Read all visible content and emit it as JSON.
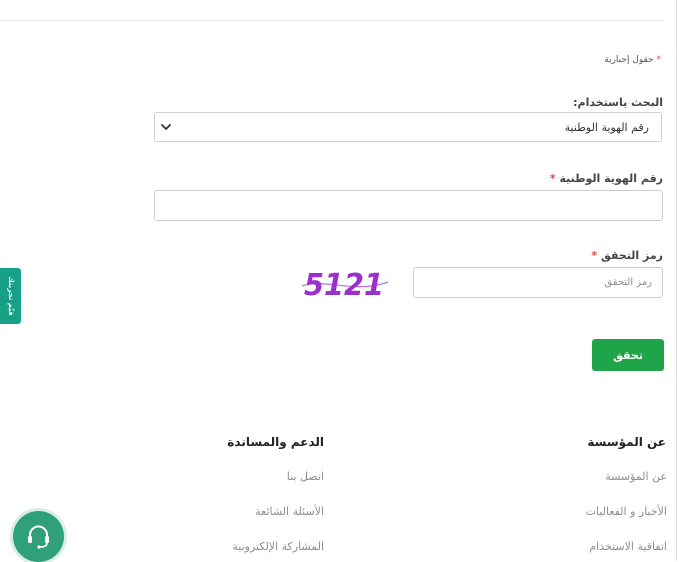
{
  "form": {
    "required_note": "حقول إجبارية",
    "search_by_label": "البحث باستخدام:",
    "search_by_value": "رقم الهوية الوطنية",
    "id_label": "رقم الهوية الوطنية",
    "captcha_label": "رمز التحقق",
    "captcha_placeholder": "رمز التحقق",
    "captcha_text": "5121",
    "submit_label": "تحقق"
  },
  "side_tab": {
    "label": "قيّم تجربتك"
  },
  "footer": {
    "about": {
      "title": "عن المؤسسة",
      "links": [
        "عن المؤسسة",
        "الأخبار و الفعاليات",
        "اتفاقية الاستخدام"
      ]
    },
    "support": {
      "title": "الدعم والمساندة",
      "links": [
        "اتصل بنا",
        "الأسئلة الشائعة",
        "المشاركة الإلكترونية"
      ]
    }
  },
  "colors": {
    "primary_green": "#1fa44a",
    "side_tab_green": "#16a085",
    "captcha_purple": "#9b2fcf",
    "required_star": "#e04848"
  },
  "icons": {
    "select_chevron": "chevron-down-icon",
    "support": "headset-icon"
  }
}
